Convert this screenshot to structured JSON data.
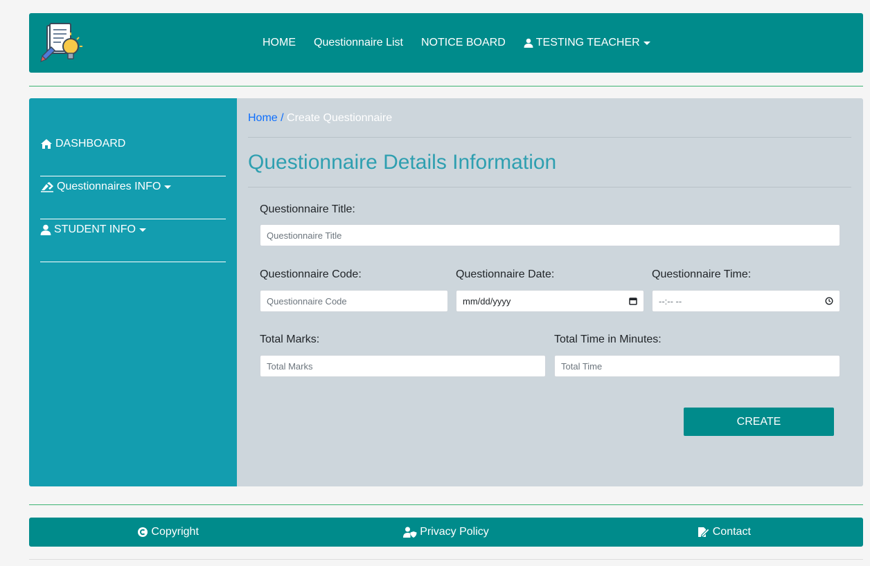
{
  "header": {
    "nav": [
      {
        "label": "HOME"
      },
      {
        "label": "Questionnaire List"
      },
      {
        "label": "NOTICE BOARD"
      },
      {
        "label": "TESTING TEACHER",
        "icon": "user-icon",
        "dropdown": true
      }
    ]
  },
  "sidebar": {
    "items": [
      {
        "label": "DASHBOARD",
        "icon": "home-icon",
        "dropdown": false
      },
      {
        "label": "Questionnaires INFO",
        "icon": "pen-icon",
        "dropdown": true
      },
      {
        "label": "STUDENT INFO",
        "icon": "user-icon",
        "dropdown": true
      }
    ]
  },
  "breadcrumb": {
    "home": "Home",
    "separator": " / ",
    "current": "Create Questionnaire"
  },
  "form": {
    "title": "Questionnaire Details Information",
    "fields": {
      "title": {
        "label": "Questionnaire Title:",
        "placeholder": "Questionnaire Title"
      },
      "code": {
        "label": "Questionnaire Code:",
        "placeholder": "Questionnaire Code"
      },
      "date": {
        "label": "Questionnaire Date:",
        "value": "mm/dd/yyyy"
      },
      "time": {
        "label": "Questionnaire Time:",
        "value": "--:-- --"
      },
      "marks": {
        "label": "Total Marks:",
        "placeholder": "Total Marks"
      },
      "minutes": {
        "label": "Total Time in Minutes:",
        "placeholder": "Total Time"
      }
    },
    "submit_label": "CREATE"
  },
  "footer": {
    "items": [
      {
        "label": "Copyright",
        "icon": "copyright-icon"
      },
      {
        "label": "Privacy Policy",
        "icon": "user-shield-icon"
      },
      {
        "label": "Contact",
        "icon": "edit-document-icon"
      }
    ]
  },
  "colors": {
    "primary": "#008b8b",
    "sidebar": "#139daf",
    "content_bg": "#cdd6dc",
    "title": "#2e9fb0",
    "link": "#0d6efd"
  }
}
